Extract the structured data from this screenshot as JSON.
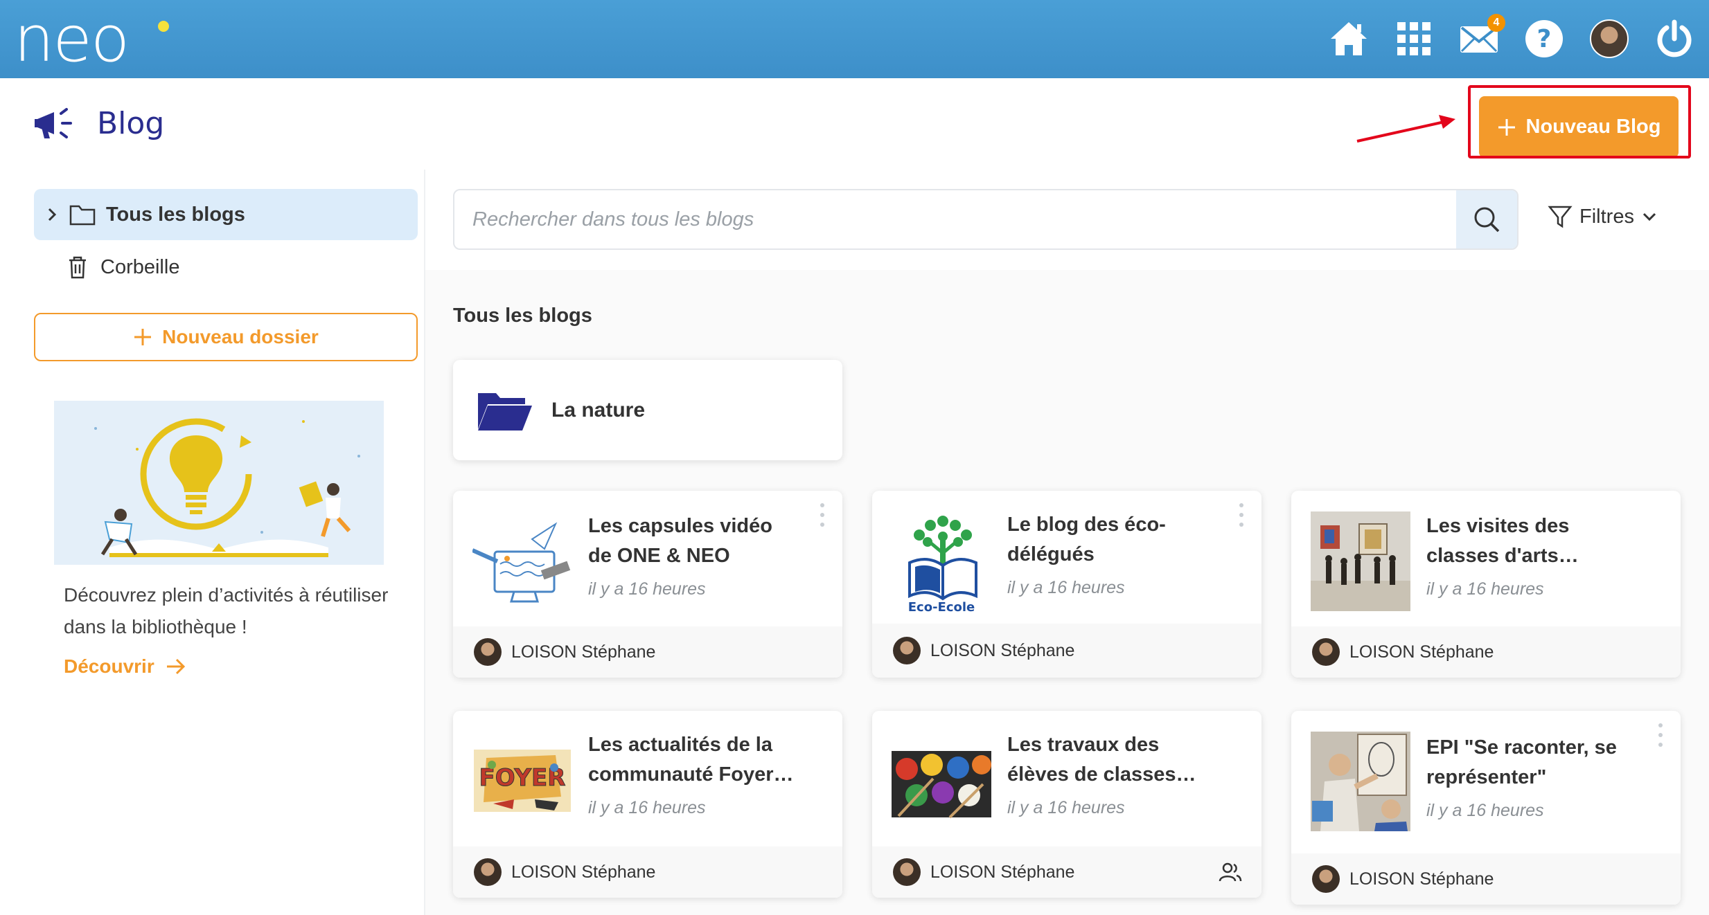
{
  "topbar": {
    "logo": "neo",
    "mail_badge": "4",
    "icons": [
      "home-icon",
      "apps-grid-icon",
      "mail-icon",
      "help-icon",
      "user-avatar",
      "power-icon"
    ],
    "colors": {
      "bar": "#3d8fc9",
      "badge": "#f39200"
    }
  },
  "header": {
    "app_title": "Blog",
    "new_blog_label": "Nouveau Blog",
    "accent": "#f39a2b"
  },
  "sidebar": {
    "items": [
      {
        "label": "Tous les blogs",
        "icon": "folder-icon",
        "active": true
      },
      {
        "label": "Corbeille",
        "icon": "trash-icon",
        "active": false
      }
    ],
    "new_folder_label": "Nouveau dossier",
    "promo": {
      "text": "Découvrez plein d’activités à réutiliser dans la bibliothèque !",
      "link": "Découvrir"
    }
  },
  "main": {
    "search_placeholder": "Rechercher dans tous les blogs",
    "filters_label": "Filtres",
    "section_title": "Tous les blogs",
    "folders": [
      {
        "name": "La nature"
      }
    ],
    "blogs": [
      {
        "title_line1": "Les capsules vidéo",
        "title_line2": "de ONE & NEO",
        "time": "il y a 16 heures",
        "author": "LOISON Stéphane",
        "thumb": "video-capsule-illustration"
      },
      {
        "title_line1": "Le blog des éco-",
        "title_line2": "délégués",
        "time": "il y a 16 heures",
        "author": "LOISON Stéphane",
        "thumb": "eco-ecole-logo",
        "thumb_label": "Eco-Ecole"
      },
      {
        "title_line1": "Les visites des",
        "title_line2": "classes d'arts…",
        "time": "il y a 16 heures",
        "author": "LOISON Stéphane",
        "thumb": "museum-photo"
      },
      {
        "title_line1": "Les actualités de la",
        "title_line2": "communauté Foyer…",
        "time": "il y a 16 heures",
        "author": "LOISON Stéphane",
        "thumb": "foyer-comic-illustration"
      },
      {
        "title_line1": "Les travaux des",
        "title_line2": "élèves de classes…",
        "time": "il y a 16 heures",
        "author": "LOISON Stéphane",
        "thumb": "paint-pots-photo",
        "shared": true
      },
      {
        "title_line1": "EPI \"Se raconter, se",
        "title_line2": "représenter\"",
        "time": "il y a 16 heures",
        "author": "LOISON Stéphane",
        "thumb": "self-portrait-photo"
      }
    ]
  }
}
